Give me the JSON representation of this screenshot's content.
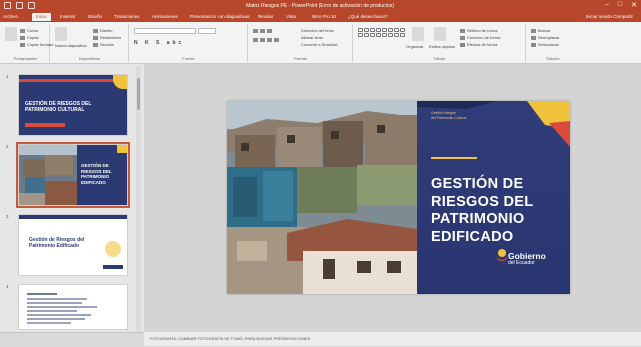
{
  "titlebar": {
    "title": "Matriz Riesgos PE - PowerPoint (Error de activación de productos)",
    "controls": [
      "–",
      "□",
      "✕"
    ]
  },
  "tabs": [
    "Archivo",
    "Inicio",
    "Insertar",
    "Diseño",
    "Transiciones",
    "Animaciones",
    "Presentación con diapositivas",
    "Revisar",
    "Vista",
    "Nitro Pro 10",
    "¿Qué desea hacer?"
  ],
  "tabs_right": "Iniciar sesión   Compartir",
  "ribbon": {
    "groups": [
      "Portapapeles",
      "Diapositivas",
      "Fuente",
      "Párrafo",
      "Dibujo",
      "Edición"
    ],
    "paste": "Pegar",
    "cut": "Cortar",
    "copy": "Copiar",
    "format_painter": "Copiar formato",
    "new_slide": "Nueva diapositiva",
    "layout": "Diseño",
    "reset": "Restablecer",
    "section": "Sección",
    "text_direction": "Dirección del texto",
    "align_text": "Alinear texto",
    "smartart": "Convertir a SmartArt",
    "arrange": "Organizar",
    "quick_styles": "Estilos rápidos",
    "shape_fill": "Relleno de forma",
    "shape_outline": "Contorno de forma",
    "shape_effects": "Efectos de forma",
    "find": "Buscar",
    "replace": "Reemplazar",
    "select": "Seleccionar"
  },
  "slides": [
    {
      "num": "1",
      "title": "GESTIÓN DE RIESGOS DEL PATRIMONIO CULTURAL"
    },
    {
      "num": "2",
      "title": "GESTIÓN DE RIESGOS DEL PATRIMONIO EDIFICADO"
    },
    {
      "num": "3",
      "title": "Gestión de Riesgos del Patrimonio Edificado"
    },
    {
      "num": "4",
      "title": ""
    }
  ],
  "main_slide": {
    "meta_line1": "Gestión Integral",
    "meta_line2": "del Patrimonio Cultural",
    "heading_lines": [
      "GESTIÓN DE",
      "RIESGOS DEL",
      "PATRIMONIO",
      "EDIFICADO"
    ],
    "logo_line1": "Gobierno",
    "logo_line2": "del Ecuador"
  },
  "notes": "FOTOGRAFÍA: CAMBIAR FOTOGRAFÍA SE TOMÓ: PARA NUEVAS PRESENTACIONES",
  "colors": {
    "accent": "#b7472a",
    "slide_blue": "#2d3a6e",
    "slide_yellow": "#f0c33c",
    "slide_red": "#d84a3a"
  }
}
